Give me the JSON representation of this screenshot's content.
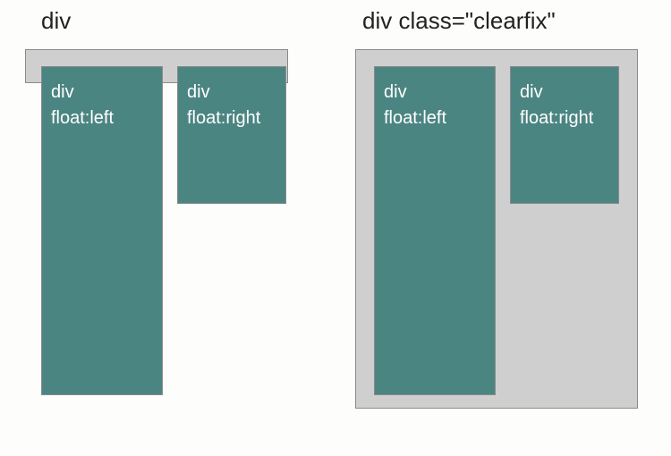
{
  "labels": {
    "left_top": "div",
    "right_top": "div   class=\"clearfix\""
  },
  "left_example": {
    "float_left": {
      "line1": "div",
      "line2": "float:left"
    },
    "float_right": {
      "line1": "div",
      "line2": "float:right"
    }
  },
  "right_example": {
    "float_left": {
      "line1": "div",
      "line2": "float:left"
    },
    "float_right": {
      "line1": "div",
      "line2": "float:right"
    }
  },
  "colors": {
    "container_bg": "#cfcfcf",
    "container_border": "#8a8a8a",
    "child_bg": "#4b8582",
    "child_text": "#ffffff"
  }
}
